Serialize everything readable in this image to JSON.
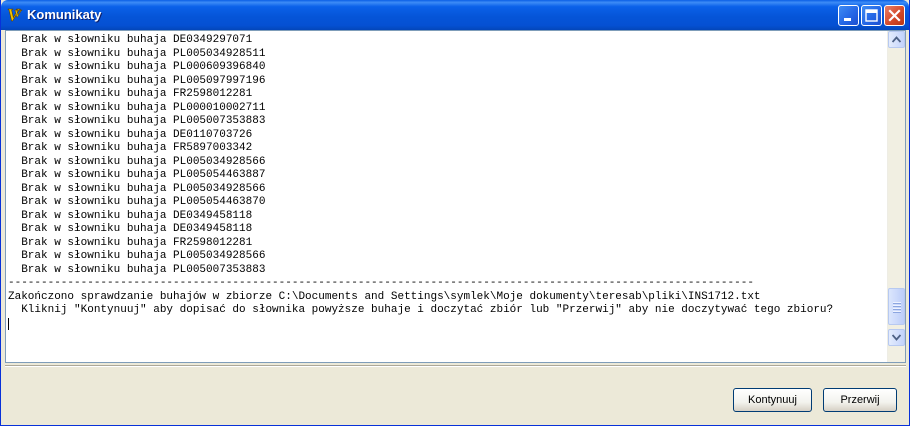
{
  "window": {
    "title": "Komunikaty"
  },
  "log": {
    "lines": [
      "  Brak w słowniku buhaja DE0349297071",
      "  Brak w słowniku buhaja PL005034928511",
      "  Brak w słowniku buhaja PL000609396840",
      "  Brak w słowniku buhaja PL005097997196",
      "  Brak w słowniku buhaja FR2598012281",
      "  Brak w słowniku buhaja PL000010002711",
      "  Brak w słowniku buhaja PL005007353883",
      "  Brak w słowniku buhaja DE0110703726",
      "  Brak w słowniku buhaja FR5897003342",
      "  Brak w słowniku buhaja PL005034928566",
      "  Brak w słowniku buhaja PL005054463887",
      "  Brak w słowniku buhaja PL005034928566",
      "  Brak w słowniku buhaja PL005054463870",
      "  Brak w słowniku buhaja DE0349458118",
      "  Brak w słowniku buhaja DE0349458118",
      "  Brak w słowniku buhaja FR2598012281",
      "  Brak w słowniku buhaja PL005034928566",
      "  Brak w słowniku buhaja PL005007353883",
      "-----------------------------------------------------------------------------------------------------------------",
      "Zakończono sprawdzanie buhajów w zbiorze C:\\Documents and Settings\\symlek\\Moje dokumenty\\teresab\\pliki\\INS1712.txt",
      "  Kliknij \"Kontynuuj\" aby dopisać do słownika powyższe buhaje i doczytać zbiór lub \"Przerwij\" aby nie doczytywać tego zbioru?"
    ]
  },
  "buttons": {
    "continue_label": "Kontynuuj",
    "abort_label": "Przerwij"
  },
  "colors": {
    "titlebar": "#0554d7",
    "close_button": "#d4492a",
    "window_bg": "#ece9d8"
  },
  "icons": {
    "app": "app-logo-icon",
    "minimize": "minimize-icon",
    "maximize": "maximize-icon",
    "close": "close-icon",
    "scroll_up": "arrow-up-icon",
    "scroll_down": "arrow-down-icon"
  }
}
